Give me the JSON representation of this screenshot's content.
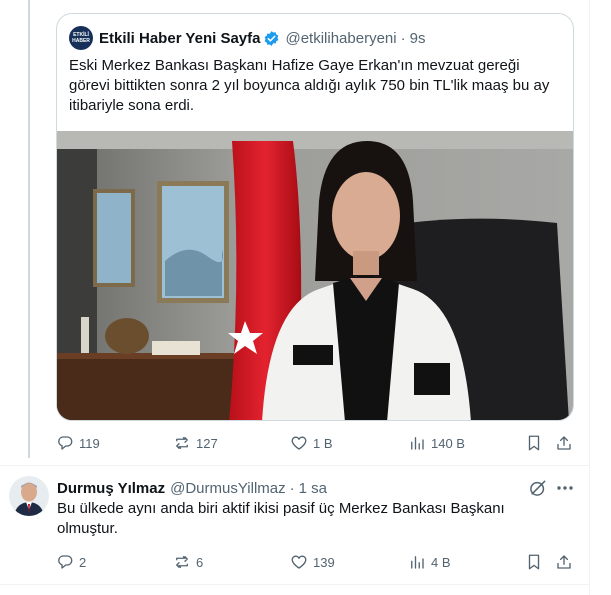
{
  "quoted_tweet": {
    "author_name": "Etkili Haber Yeni Sayfa",
    "author_handle": "@etkilihaberyeni",
    "separator": "·",
    "time": "9s",
    "avatar_text_line1": "ETKİLİ",
    "avatar_text_line2": "HABER",
    "text": "Eski Merkez Bankası Başkanı Hafize Gaye Erkan'ın mevzuat gereği görevi bittikten sonra 2 yıl boyunca aldığı aylık 750 bin TL'lik maaş bu ay itibariyle sona erdi.",
    "verified_color": "#1d9bf0"
  },
  "main_actions": {
    "replies": "119",
    "reposts": "127",
    "likes": "1 B",
    "views": "140 B"
  },
  "reply_tweet": {
    "author_name": "Durmuş Yılmaz",
    "author_handle": "@DurmusYillmaz",
    "separator": "·",
    "time": "1 sa",
    "text": "Bu ülkede aynı anda biri aktif ikisi pasif üç Merkez Bankası Başkanı olmuştur."
  },
  "reply_actions": {
    "replies": "2",
    "reposts": "6",
    "likes": "139",
    "views": "4 B"
  },
  "icons": {
    "reply": "reply-icon",
    "repost": "repost-icon",
    "like": "heart-icon",
    "views": "views-icon",
    "bookmark": "bookmark-icon",
    "share": "share-icon",
    "grok": "grok-icon",
    "more": "more-icon"
  },
  "colors": {
    "text_primary": "#0f1419",
    "text_secondary": "#536471",
    "border": "#cfd9de",
    "accent": "#1d9bf0"
  }
}
